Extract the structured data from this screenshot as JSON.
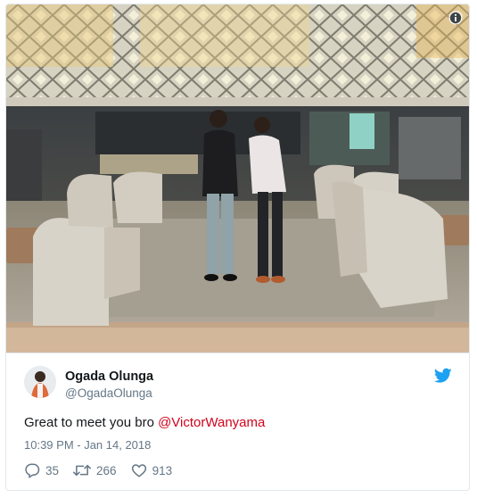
{
  "tweet": {
    "author_name": "Ogada Olunga",
    "author_handle": "@OgadaOlunga",
    "text_prefix": "Great to meet you bro ",
    "mention": "@VictorWanyama",
    "timestamp": "10:39 PM - Jan 14, 2018"
  },
  "stats": {
    "replies": "35",
    "retweets": "266",
    "likes": "913"
  },
  "icons": {
    "info": "info-icon",
    "brand": "twitter-bird-icon",
    "reply": "reply-icon",
    "retweet": "retweet-icon",
    "like": "heart-icon"
  },
  "colors": {
    "brand_blue": "#1da1f2",
    "mention": "#d0021b",
    "secondary_text": "#657786"
  }
}
